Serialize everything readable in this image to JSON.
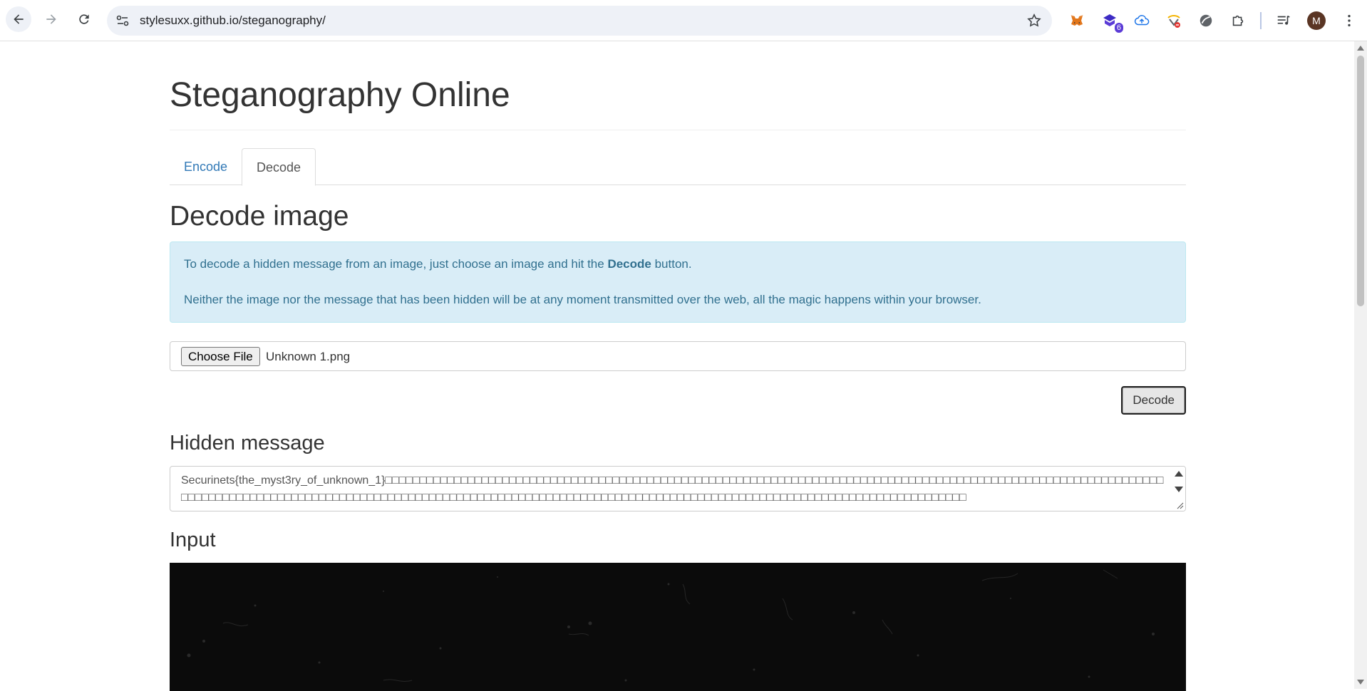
{
  "browser": {
    "url": "stylesuxx.github.io/steganography/",
    "extension_badge": "6",
    "profile_initial": "M",
    "icons": [
      "back-icon",
      "forward-icon",
      "reload-icon",
      "site-settings-icon",
      "bookmark-star-icon",
      "metamask-icon",
      "extension-icon",
      "cloud-upload-icon",
      "extension-icon",
      "globe-icon",
      "puzzle-icon",
      "media-icon",
      "menu-icon"
    ]
  },
  "page": {
    "title": "Steganography Online",
    "tabs": [
      {
        "label": "Encode",
        "active": false
      },
      {
        "label": "Decode",
        "active": true
      }
    ],
    "decode_heading": "Decode image",
    "info": {
      "p1_before": "To decode a hidden message from an image, just choose an image and hit the ",
      "p1_bold": "Decode",
      "p1_after": " button.",
      "p2": "Neither the image nor the message that has been hidden will be at any moment transmitted over the web, all the magic happens within your browser."
    },
    "file_input": {
      "button_label": "Choose File",
      "file_name": "Unknown 1.png"
    },
    "decode_button": "Decode",
    "hidden_heading": "Hidden message",
    "hidden_message": "Securinets{the_myst3ry_of_unknown_1}□□□□□□□□□□□□□□□□□□□□□□□□□□□□□□□□□□□□□□□□□□□□□□□□□□□□□□□□□□□□□□□□□□□□□□□□□□□□□□□□□□□□□□□□□□□□□□□□□□□□□□□□□□□□□□□□□□□□□□□□□□□□□□□□□□□□□□□□□□□□□□□□□□□□□□□□□□□□□□□□□□□□□□□□□□□□□□□□□□□□□□□□□□□□□□□□□□□□□□□□□□□□□□□□□□□□□□□□□□□□□□□□□□□",
    "input_heading": "Input",
    "colors": {
      "link": "#337ab7",
      "info_bg": "#d9edf7",
      "info_text": "#31708f",
      "input_image_bg": "#0b0b0b"
    }
  }
}
